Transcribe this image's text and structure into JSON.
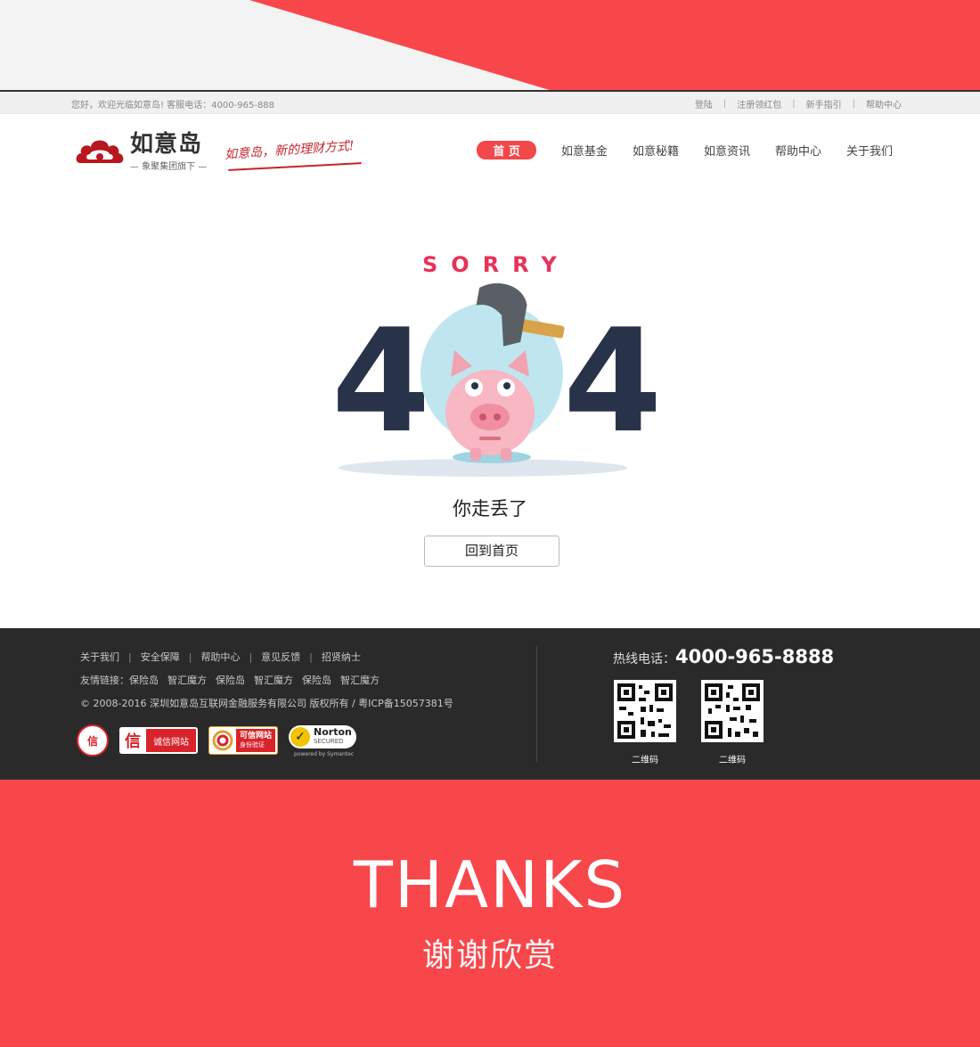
{
  "topbar": {
    "welcome": "您好，欢迎光临如意岛!  客服电话：4000-965-888",
    "links": [
      "登陆",
      "注册领红包",
      "新手指引",
      "帮助中心"
    ]
  },
  "header": {
    "brand_name": "如意岛",
    "brand_sub": "— 象聚集团旗下 —",
    "slogan": "如意岛，新的理财方式!",
    "nav": [
      "首 页",
      "如意基金",
      "如意秘籍",
      "如意资讯",
      "帮助中心",
      "关于我们"
    ]
  },
  "error": {
    "sorry": "SORRY",
    "digit_left": "4",
    "digit_right": "4",
    "message": "你走丢了",
    "home_button": "回到首页"
  },
  "footer": {
    "links": [
      "关于我们",
      "安全保障",
      "帮助中心",
      "意见反馈",
      "招贤纳士"
    ],
    "friends": [
      "友情链接：保险岛",
      "智汇魔方",
      "保险岛",
      "智汇魔方",
      "保险岛",
      "智汇魔方"
    ],
    "copyright": "© 2008-2016 深圳如意岛互联网金融服务有限公司 版权所有 / 粤ICP备15057381号",
    "badges": {
      "round": "信",
      "credit_icon": "信",
      "credit_text": "诚信网站",
      "site_line1": "可信网站",
      "site_line2": "身份验证",
      "norton_line1": "Norton",
      "norton_line2": "SECURED",
      "norton_powered": "powered by Symantec"
    },
    "hotline_label": "热线电话：",
    "hotline_number": "4000-965-8888",
    "qr_captions": [
      "二维码",
      "二维码"
    ]
  },
  "thanks": {
    "en": "THANKS",
    "cn": "谢谢欣赏"
  },
  "colors": {
    "accent": "#f7474b",
    "nav_active": "#f2474b",
    "digit": "#28334a",
    "sorry": "#e6335a",
    "footer_bg": "#2a2a2a"
  }
}
